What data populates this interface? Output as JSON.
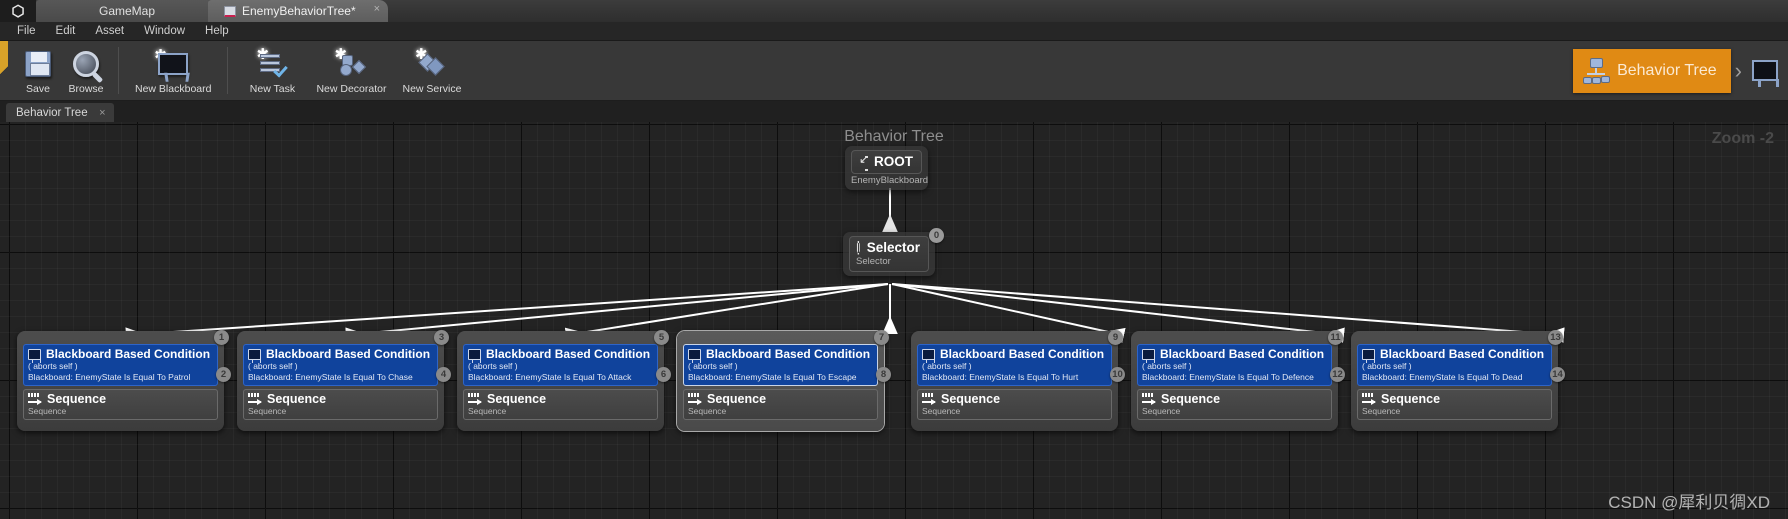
{
  "window": {
    "logo": "unreal-u",
    "tabs": [
      {
        "label": "GameMap",
        "icon": "map-tab-icon",
        "active": false
      },
      {
        "label": "EnemyBehaviorTree*",
        "icon": "behavior-tree-tab-icon",
        "active": true,
        "close": "×"
      }
    ]
  },
  "menubar": {
    "items": [
      "File",
      "Edit",
      "Asset",
      "Window",
      "Help"
    ]
  },
  "toolbar": {
    "buttons": [
      {
        "label": "Save",
        "icon": "save-icon"
      },
      {
        "label": "Browse",
        "icon": "browse-magnifier-icon"
      },
      {
        "label": "New Blackboard",
        "icon": "new-blackboard-icon"
      },
      {
        "label": "New Task",
        "icon": "new-task-icon"
      },
      {
        "label": "New Decorator",
        "icon": "new-decorator-icon"
      },
      {
        "label": "New Service",
        "icon": "new-service-icon"
      }
    ],
    "mode_switch": {
      "active_label": "Behavior Tree",
      "active_icon": "behavior-tree-icon",
      "active_color": "#e08a14",
      "chevron": "›",
      "inactive_icon": "blackboard-icon"
    }
  },
  "panel_tabs": [
    {
      "label": "Behavior Tree",
      "close": "×"
    }
  ],
  "graph": {
    "title": "Behavior Tree",
    "zoom_label": "Zoom -2",
    "watermark": "CSDN @犀利贝徟XD",
    "root": {
      "title": "ROOT",
      "subtitle": "EnemyBlackboard",
      "icon": "root-icon"
    },
    "selector": {
      "title": "Selector",
      "subtitle": "Selector",
      "icon": "selector-icon",
      "pin_index": "0"
    },
    "children": [
      {
        "decorator_title": "Blackboard Based Condition",
        "decorator_aborts": "( aborts self )",
        "decorator_detail": "Blackboard: EnemyState Is Equal To Patrol",
        "decorator_icon": "blackboard-icon",
        "task_title": "Sequence",
        "task_subtitle": "Sequence",
        "task_icon": "sequence-icon",
        "pin_top": "1",
        "pin_side": "2",
        "selected": false
      },
      {
        "decorator_title": "Blackboard Based Condition",
        "decorator_aborts": "( aborts self )",
        "decorator_detail": "Blackboard: EnemyState Is Equal To Chase",
        "decorator_icon": "blackboard-icon",
        "task_title": "Sequence",
        "task_subtitle": "Sequence",
        "task_icon": "sequence-icon",
        "pin_top": "3",
        "pin_side": "4",
        "selected": false
      },
      {
        "decorator_title": "Blackboard Based Condition",
        "decorator_aborts": "( aborts self )",
        "decorator_detail": "Blackboard: EnemyState Is Equal To Attack",
        "decorator_icon": "blackboard-icon",
        "task_title": "Sequence",
        "task_subtitle": "Sequence",
        "task_icon": "sequence-icon",
        "pin_top": "5",
        "pin_side": "6",
        "selected": false
      },
      {
        "decorator_title": "Blackboard Based Condition",
        "decorator_aborts": "( aborts self )",
        "decorator_detail": "Blackboard: EnemyState Is Equal To Escape",
        "decorator_icon": "blackboard-icon",
        "task_title": "Sequence",
        "task_subtitle": "Sequence",
        "task_icon": "sequence-icon",
        "pin_top": "7",
        "pin_side": "8",
        "selected": true
      },
      {
        "decorator_title": "Blackboard Based Condition",
        "decorator_aborts": "( aborts self )",
        "decorator_detail": "Blackboard: EnemyState Is Equal To Hurt",
        "decorator_icon": "blackboard-icon",
        "task_title": "Sequence",
        "task_subtitle": "Sequence",
        "task_icon": "sequence-icon",
        "pin_top": "9",
        "pin_side": "10",
        "selected": false
      },
      {
        "decorator_title": "Blackboard Based Condition",
        "decorator_aborts": "( aborts self )",
        "decorator_detail": "Blackboard: EnemyState Is Equal To Defence",
        "decorator_icon": "blackboard-icon",
        "task_title": "Sequence",
        "task_subtitle": "Sequence",
        "task_icon": "sequence-icon",
        "pin_top": "11",
        "pin_side": "12",
        "selected": false
      },
      {
        "decorator_title": "Blackboard Based Condition",
        "decorator_aborts": "( aborts self )",
        "decorator_detail": "Blackboard: EnemyState Is Equal To Dead",
        "decorator_icon": "blackboard-icon",
        "task_title": "Sequence",
        "task_subtitle": "Sequence",
        "task_icon": "sequence-icon",
        "pin_top": "13",
        "pin_side": "14",
        "selected": false
      }
    ]
  }
}
